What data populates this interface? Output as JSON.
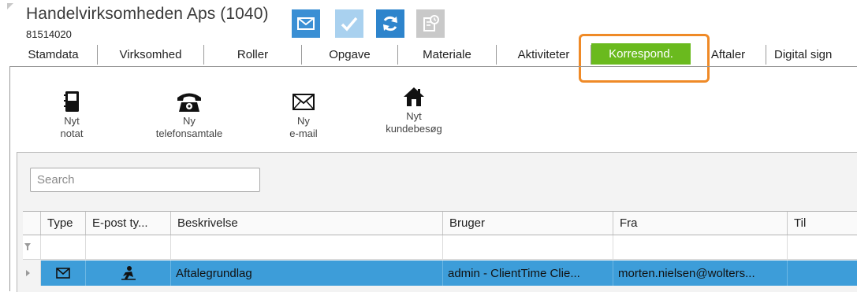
{
  "header": {
    "company_name": "Handelvirksomheden Aps (1040)",
    "company_code": "81514020",
    "buttons": [
      {
        "name": "mail",
        "icon": "envelope-icon",
        "color": "#3a8fd4"
      },
      {
        "name": "check",
        "icon": "checkmark-icon",
        "color": "#a9d1ef"
      },
      {
        "name": "sync",
        "icon": "sync-icon",
        "color": "#2d84cc"
      },
      {
        "name": "task",
        "icon": "task-clock-icon",
        "color": "#c9c9c9"
      }
    ]
  },
  "tabs": [
    {
      "label": "Stamdata"
    },
    {
      "label": "Virksomhed"
    },
    {
      "label": "Roller"
    },
    {
      "label": "Opgave"
    },
    {
      "label": "Materiale"
    },
    {
      "label": "Aktiviteter"
    },
    {
      "label": "Korrespond.",
      "active": true
    },
    {
      "label": "Aftaler"
    },
    {
      "label": "Digital sign"
    }
  ],
  "actions": {
    "note": {
      "line1": "Nyt",
      "line2": "notat",
      "icon": "notebook-icon"
    },
    "phone": {
      "line1": "Ny",
      "line2": "telefonsamtale",
      "icon": "telephone-icon"
    },
    "email": {
      "line1": "Ny",
      "line2": "e-mail",
      "icon": "envelope-icon"
    },
    "visit": {
      "line1": "Nyt",
      "line2": "kundebesøg",
      "icon": "house-icon"
    }
  },
  "search": {
    "placeholder": "Search"
  },
  "grid": {
    "columns": [
      "Type",
      "E-post ty...",
      "Beskrivelse",
      "Bruger",
      "Fra",
      "Til"
    ],
    "rows": [
      {
        "type_icon": "envelope-icon",
        "epost_icon": "person-arrow-icon",
        "beskrivelse": "Aftalegrundlag",
        "bruger": "admin - ClientTime Clie...",
        "fra": "morten.nielsen@wolters...",
        "til": ""
      }
    ]
  },
  "colors": {
    "active_tab": "#6aba1e",
    "highlight": "#ef8a27",
    "selected_row": "#3d9dd9"
  }
}
